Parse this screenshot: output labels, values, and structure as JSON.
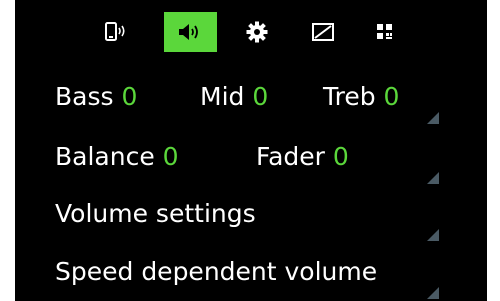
{
  "tabs": [
    {
      "icon": "phone-bluetooth-icon",
      "active": false
    },
    {
      "icon": "speaker-sound-icon",
      "active": true
    },
    {
      "icon": "gear-icon",
      "active": false
    },
    {
      "icon": "display-brightness-icon",
      "active": false
    },
    {
      "icon": "grid-apps-icon",
      "active": false
    }
  ],
  "rows": {
    "tone": {
      "bass_label": "Bass",
      "bass_value": "0",
      "mid_label": "Mid",
      "mid_value": "0",
      "treb_label": "Treb",
      "treb_value": "0"
    },
    "balance": {
      "balance_label": "Balance",
      "balance_value": "0",
      "fader_label": "Fader",
      "fader_value": "0"
    },
    "volume_settings": {
      "label": "Volume settings"
    },
    "speed_volume": {
      "label": "Speed dependent volume"
    }
  },
  "colors": {
    "accent": "#5bd73b",
    "background": "#000000",
    "text": "#ffffff",
    "corner_marker": "#4a5a64"
  }
}
